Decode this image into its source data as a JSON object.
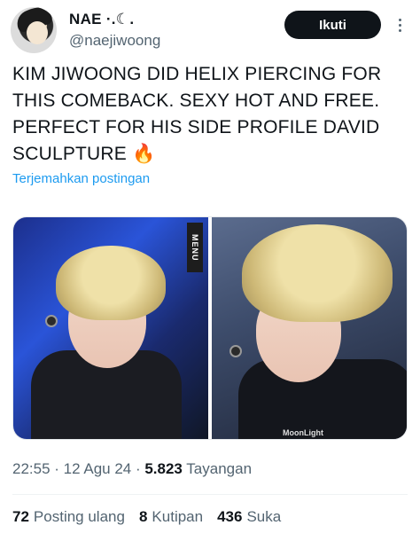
{
  "author": {
    "display_name": "NAE ·.☾.",
    "handle": "@naejiwoong"
  },
  "header": {
    "follow_label": "Ikuti"
  },
  "tweet": {
    "text": "KIM JIWOONG DID HELIX PIERCING FOR THIS COMEBACK. SEXY HOT AND FREE. PERFECT FOR HIS SIDE PROFILE DAVID SCULPTURE 🔥",
    "translate_label": "Terjemahkan postingan"
  },
  "media": {
    "left_sign_text": "MENU",
    "right_watermark": "MoonLight"
  },
  "meta": {
    "time": "22:55",
    "sep1": " · ",
    "date": "12 Agu 24",
    "sep2": " · ",
    "views_count": "5.823",
    "views_label": " Tayangan"
  },
  "stats": {
    "reposts_count": "72",
    "reposts_label": "Posting ulang",
    "quotes_count": "8",
    "quotes_label": "Kutipan",
    "likes_count": "436",
    "likes_label": "Suka"
  },
  "colors": {
    "link": "#1d9bf0",
    "secondary_text": "#536471",
    "primary_text": "#0f1419",
    "button_bg": "#0f1419"
  },
  "icons": {
    "more": "more-options-icon"
  }
}
